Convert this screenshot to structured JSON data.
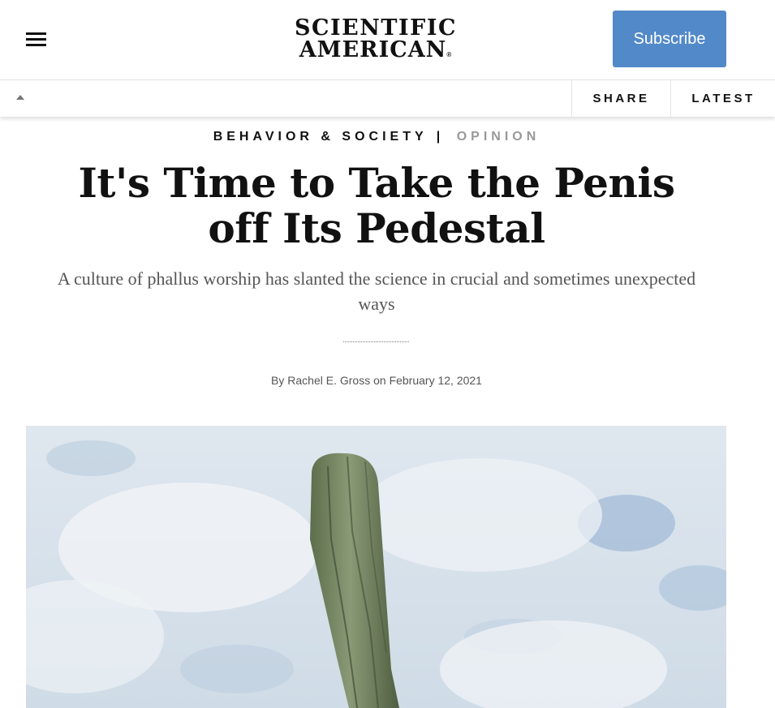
{
  "header": {
    "logo_line1": "SCIENTIFIC",
    "logo_line2": "AMERICAN",
    "logo_reg": "®",
    "subscribe_label": "Subscribe",
    "accent_color": "#5289c8"
  },
  "subbar": {
    "share_label": "SHARE",
    "latest_label": "LATEST"
  },
  "article": {
    "category": "BEHAVIOR & SOCIETY",
    "separator": "|",
    "type": "OPINION",
    "title": "It's Time to Take the Penis off Its Pedestal",
    "dek": "A culture of phallus worship has slanted the science in crucial and sometimes unexpected ways",
    "byline_prefix": "By",
    "author": "Rachel E. Gross",
    "byline_on": "on",
    "date": "February 12, 2021"
  },
  "icons": {
    "menu": "hamburger-menu-icon",
    "collapse": "caret-up-icon"
  }
}
